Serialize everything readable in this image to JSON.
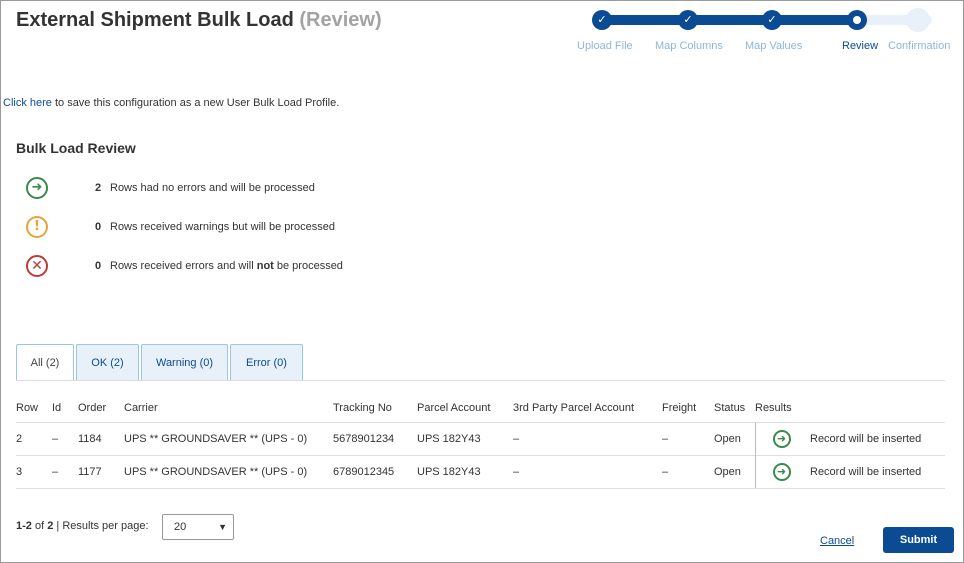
{
  "page": {
    "title": "External Shipment Bulk Load",
    "title_suffix": "(Review)"
  },
  "stepper": {
    "steps": [
      {
        "label": "Upload File",
        "state": "done"
      },
      {
        "label": "Map Columns",
        "state": "done"
      },
      {
        "label": "Map Values",
        "state": "done"
      },
      {
        "label": "Review",
        "state": "current"
      },
      {
        "label": "Confirmation",
        "state": "future"
      }
    ]
  },
  "profile": {
    "link_text": "Click here",
    "text": " to save this configuration as a new User Bulk Load Profile."
  },
  "review": {
    "title": "Bulk Load Review",
    "ok": {
      "count": "2",
      "text": "Rows had no errors and will be processed"
    },
    "warning": {
      "count": "0",
      "text": "Rows received warnings but will be processed"
    },
    "error": {
      "count": "0",
      "text_before": "Rows received errors and will ",
      "text_bold": "not",
      "text_after": " be processed"
    }
  },
  "tabs": [
    {
      "label": "All (2)",
      "active": true
    },
    {
      "label": "OK (2)",
      "active": false
    },
    {
      "label": "Warning (0)",
      "active": false
    },
    {
      "label": "Error (0)",
      "active": false
    }
  ],
  "table": {
    "headers": [
      "Row",
      "Id",
      "Order",
      "Carrier",
      "Tracking No",
      "Parcel Account",
      "3rd Party Parcel Account",
      "Freight",
      "Status",
      "Results",
      ""
    ],
    "rows": [
      {
        "row": "2",
        "id": "–",
        "order": "1184",
        "carrier": "UPS ** GROUNDSAVER ** (UPS - 0)",
        "tracking": "5678901234",
        "parcel_account": "UPS 182Y43",
        "third_party": "–",
        "freight": "–",
        "status": "Open",
        "result_icon": "arrow-right-circle-icon",
        "result": "Record will be inserted"
      },
      {
        "row": "3",
        "id": "–",
        "order": "1177",
        "carrier": "UPS ** GROUNDSAVER ** (UPS - 0)",
        "tracking": "6789012345",
        "parcel_account": "UPS 182Y43",
        "third_party": "–",
        "freight": "–",
        "status": "Open",
        "result_icon": "arrow-right-circle-icon",
        "result": "Record will be inserted"
      }
    ]
  },
  "pager": {
    "range": "1-2",
    "of_text": " of ",
    "total": "2",
    "separator": " | ",
    "per_page_label": "Results per page:",
    "per_page_value": "20"
  },
  "actions": {
    "cancel": "Cancel",
    "submit": "Submit"
  },
  "colors": {
    "primary": "#0a4b94",
    "ok": "#3a8a4d",
    "warning": "#e9a33d",
    "error": "#c0393b"
  }
}
